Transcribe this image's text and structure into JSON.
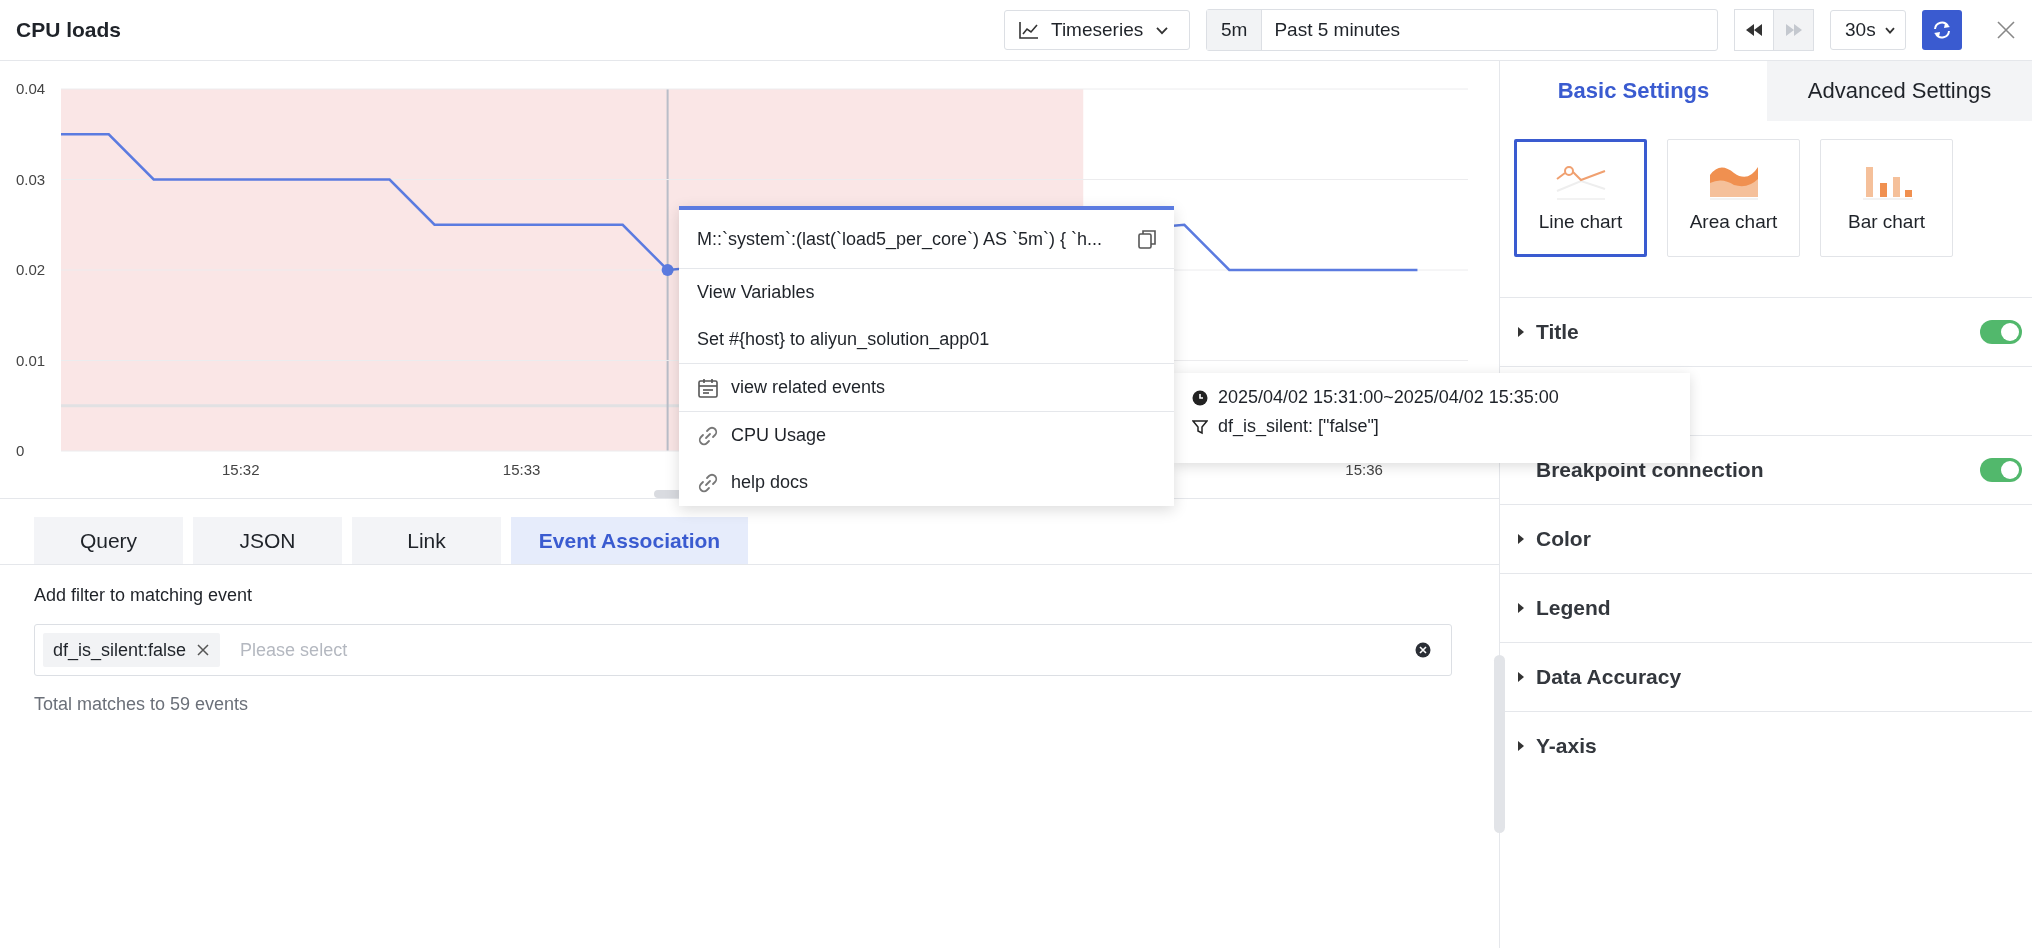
{
  "header": {
    "title": "CPU loads",
    "chart_type": "Timeseries",
    "time_short": "5m",
    "time_range": "Past 5 minutes",
    "nav_buttons": [
      {
        "kind": "rewind",
        "disabled": false
      },
      {
        "kind": "forward",
        "disabled": true
      }
    ],
    "refresh_interval": "30s"
  },
  "chart": {
    "chart_data": {
      "type": "line",
      "grid": true,
      "x": [
        931.36,
        931.53,
        931.69,
        932.53,
        932.69,
        933.36,
        933.52,
        935.36,
        935.52,
        936.19
      ],
      "series": [
        {
          "color": "#5b7be0",
          "values": [
            0.035,
            0.035,
            0.03,
            0.03,
            0.025,
            0.025,
            0.02,
            0.025,
            0.02,
            0.02
          ]
        }
      ],
      "xlim": [
        931.36,
        936.37
      ],
      "ylim": [
        0,
        0.04
      ],
      "xticks": [
        {
          "value": 932,
          "label": "15:32"
        },
        {
          "value": 933,
          "label": "15:33"
        },
        {
          "value": 936,
          "label": "15:36"
        }
      ],
      "yticks": [
        {
          "value": 0,
          "label": "0"
        },
        {
          "value": 0.01,
          "label": "0.01"
        },
        {
          "value": 0.02,
          "label": "0.02"
        },
        {
          "value": 0.03,
          "label": "0.03"
        },
        {
          "value": 0.04,
          "label": "0.04"
        }
      ],
      "bands": [
        {
          "axis": "x",
          "from": 931,
          "to": 935
        }
      ],
      "ref_lines": [
        {
          "axis": "y",
          "value": 0.005
        },
        {
          "axis": "x",
          "value": 933.52
        }
      ]
    }
  },
  "context_menu": {
    "query": "M::`system`:(last(`load5_per_core`) AS `5m`) { `h...",
    "sections": [
      {
        "items": [
          {
            "label": "View Variables",
            "kind": "plain"
          },
          {
            "label": "Set #{host} to aliyun_solution_app01",
            "kind": "plain"
          }
        ]
      },
      {
        "items": [
          {
            "label": "view related events",
            "kind": "event"
          }
        ]
      },
      {
        "items": [
          {
            "label": "CPU Usage",
            "kind": "link"
          },
          {
            "label": "help docs",
            "kind": "link"
          }
        ]
      }
    ]
  },
  "tooltip": {
    "time": "2025/04/02 15:31:00~2025/04/02 15:35:00",
    "filter": "df_is_silent: [\"false\"]"
  },
  "editor_tabs": [
    {
      "label": "Query",
      "selected": false
    },
    {
      "label": "JSON",
      "selected": false
    },
    {
      "label": "Link",
      "selected": false
    },
    {
      "label": "Event Association",
      "selected": true
    }
  ],
  "event_association": {
    "label": "Add filter to matching event",
    "tags": [
      {
        "label": "df_is_silent:false"
      }
    ],
    "placeholder": "Please select",
    "summary": "Total matches to 59 events"
  },
  "settings": {
    "tabs": [
      {
        "label": "Basic Settings",
        "selected": true
      },
      {
        "label": "Advanced Settings",
        "selected": false
      }
    ],
    "chart_types": [
      {
        "label": "Line chart",
        "kind": "line",
        "selected": true
      },
      {
        "label": "Area chart",
        "kind": "area",
        "selected": false
      },
      {
        "label": "Bar chart",
        "kind": "bar",
        "selected": false
      }
    ],
    "rows": [
      {
        "label": "Title",
        "kind": "section",
        "expanded": false,
        "on": true
      },
      {
        "kind": "covered"
      },
      {
        "label": "Breakpoint connection",
        "kind": "option",
        "on": true
      },
      {
        "label": "Color",
        "kind": "section",
        "expanded": false
      },
      {
        "label": "Legend",
        "kind": "section",
        "expanded": false
      },
      {
        "label": "Data Accuracy",
        "kind": "section",
        "expanded": false
      },
      {
        "label": "Y-axis",
        "kind": "section",
        "expanded": false
      }
    ]
  }
}
